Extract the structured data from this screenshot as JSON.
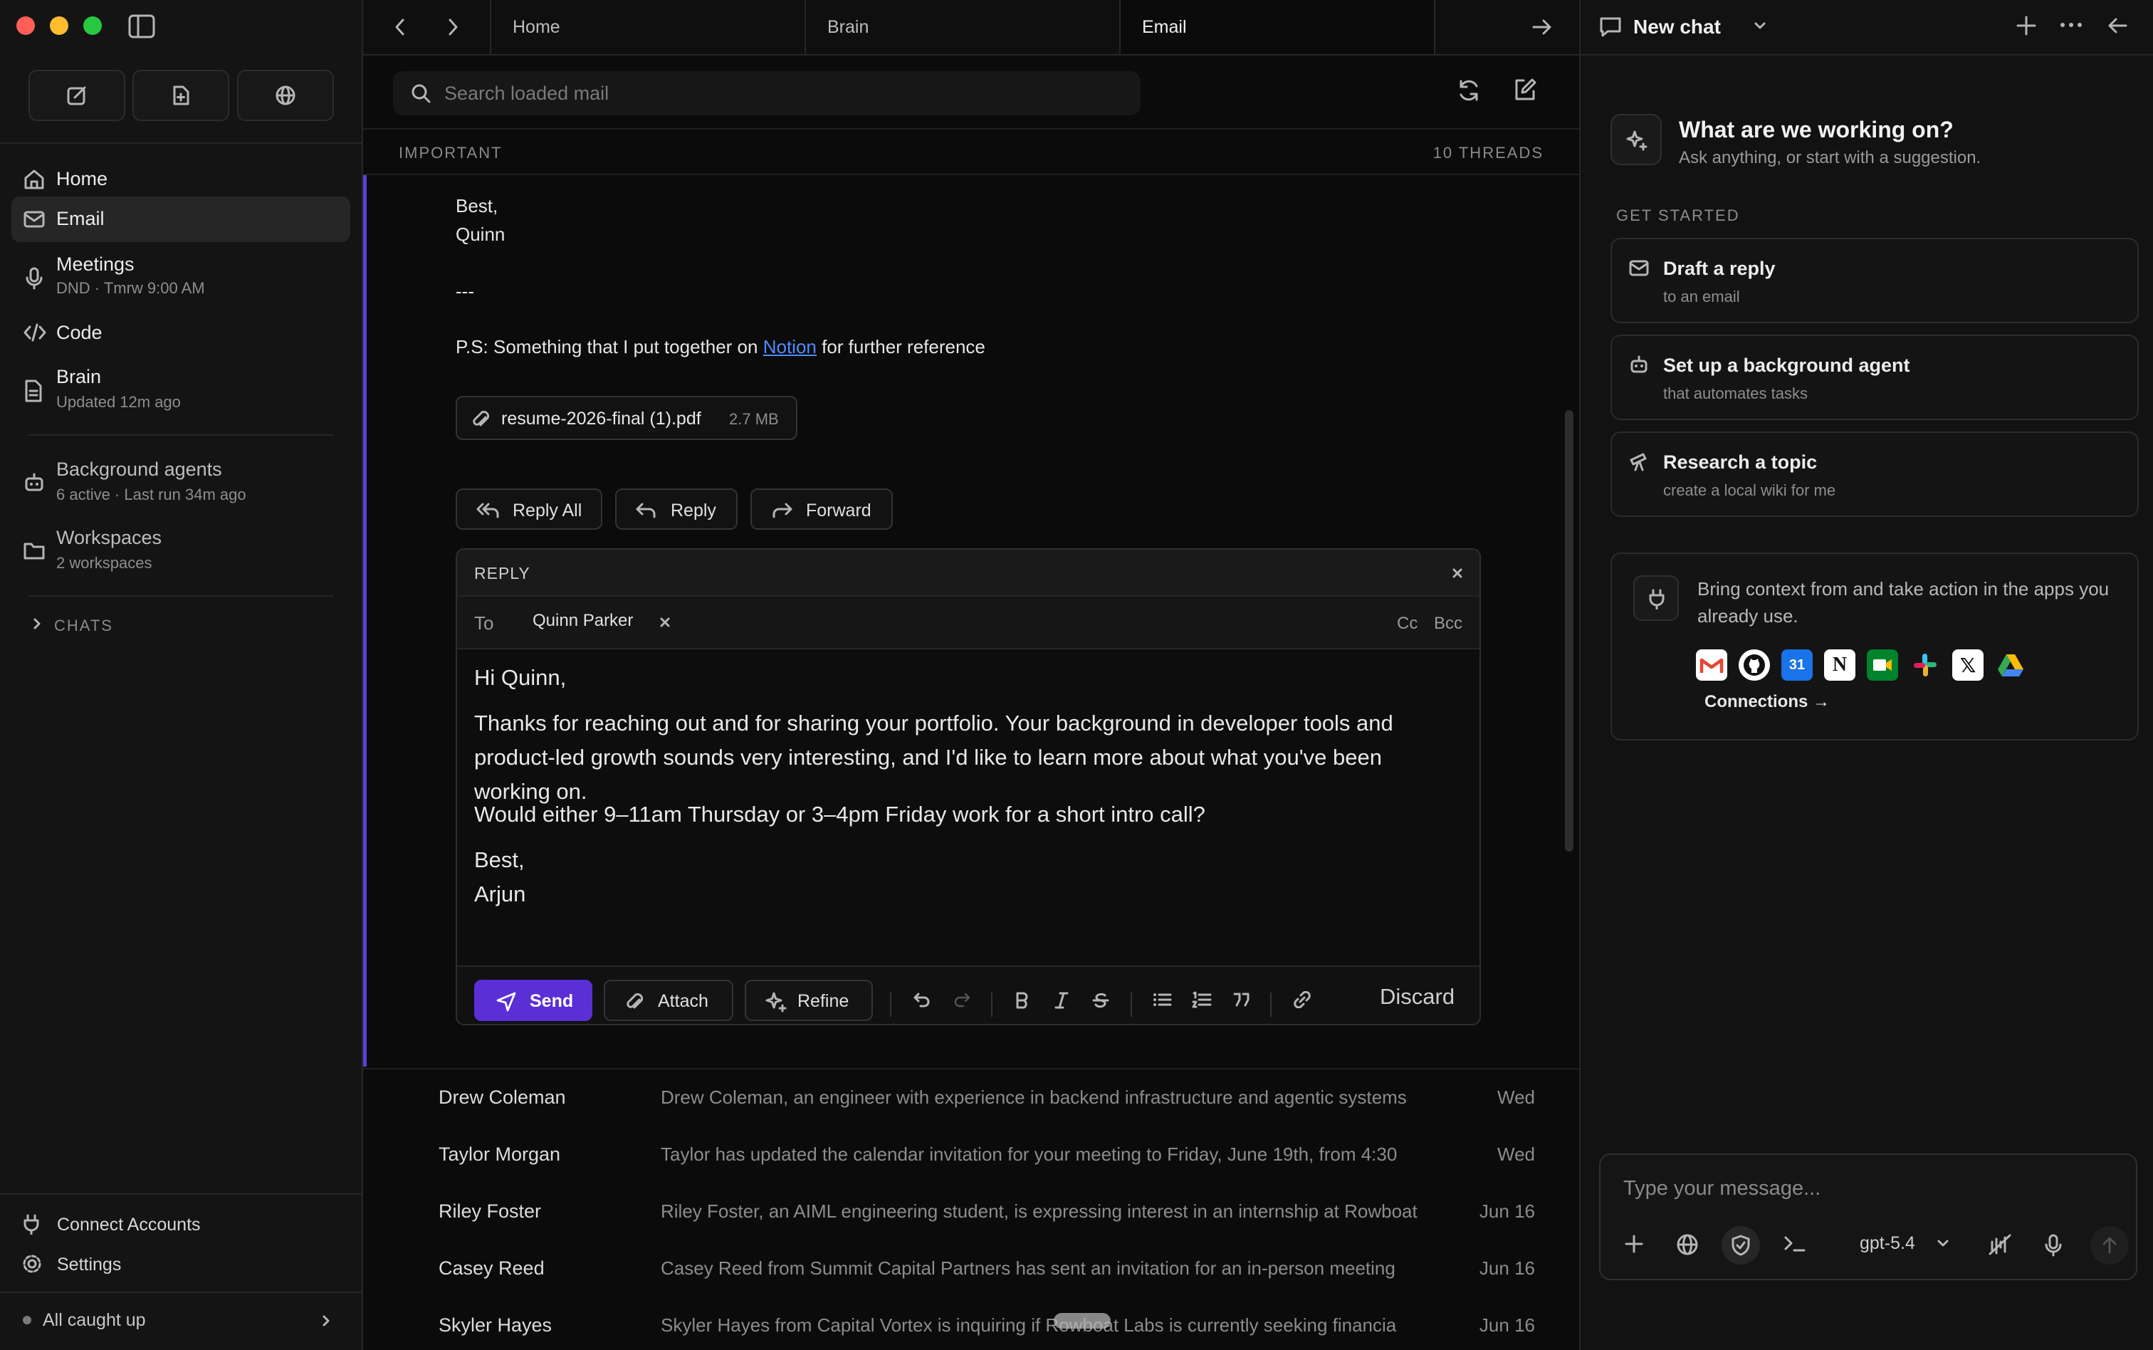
{
  "sidebar": {
    "nav": [
      {
        "label": "Home",
        "sub": ""
      },
      {
        "label": "Email",
        "sub": ""
      },
      {
        "label": "Meetings",
        "sub": "DND · Tmrw 9:00 AM"
      },
      {
        "label": "Code",
        "sub": ""
      },
      {
        "label": "Brain",
        "sub": "Updated 12m ago"
      },
      {
        "label": "Background agents",
        "sub": "6 active · Last run 34m ago"
      },
      {
        "label": "Workspaces",
        "sub": "2 workspaces"
      }
    ],
    "chats_label": "CHATS",
    "connect_accounts": "Connect Accounts",
    "settings": "Settings",
    "status": "All caught up"
  },
  "tabs": [
    "Home",
    "Brain",
    "Email"
  ],
  "mail": {
    "search_placeholder": "Search loaded mail",
    "section_label": "IMPORTANT",
    "thread_count": "10 THREADS",
    "body": {
      "signoff": "Best,",
      "signer": "Quinn",
      "separator": "---",
      "ps_before": "P.S: Something that I put together on ",
      "ps_link": "Notion",
      "ps_after": " for further reference"
    },
    "attachment": {
      "name": "resume-2026-final (1).pdf",
      "size": "2.7 MB"
    },
    "actions": {
      "reply_all": "Reply All",
      "reply": "Reply",
      "forward": "Forward"
    },
    "reply": {
      "title": "REPLY",
      "to_label": "To",
      "recipient": "Quinn Parker",
      "cc": "Cc",
      "bcc": "Bcc",
      "greeting": "Hi Quinn,",
      "para1": "Thanks for reaching out and for sharing your portfolio. Your background in developer tools and product-led growth sounds very interesting, and I'd like to learn more about what you've been working on.",
      "para2": "Would either 9–11am Thursday or 3–4pm Friday work for a short intro call?",
      "closing": "Best,",
      "name": "Arjun",
      "send": "Send",
      "attach": "Attach",
      "refine": "Refine",
      "discard": "Discard"
    },
    "threads": [
      {
        "sender": "Drew Coleman",
        "snippet": "Drew Coleman, an engineer with experience in backend infrastructure and agentic systems",
        "date": "Wed"
      },
      {
        "sender": "Taylor Morgan",
        "snippet": "Taylor has updated the calendar invitation for your meeting to Friday, June 19th, from 4:30",
        "date": "Wed"
      },
      {
        "sender": "Riley Foster",
        "snippet": "Riley Foster, an AIML engineering student, is expressing interest in an internship at Rowboat",
        "date": "Jun 16"
      },
      {
        "sender": "Casey Reed",
        "snippet": "Casey Reed from Summit Capital Partners has sent an invitation for an in-person meeting",
        "date": "Jun 16"
      },
      {
        "sender": "Skyler Hayes",
        "snippet": "Skyler Hayes from Capital Vortex is inquiring if Rowboat Labs is currently seeking financia",
        "date": "Jun 16"
      }
    ]
  },
  "chat": {
    "title": "New chat",
    "heading": "What are we working on?",
    "subheading": "Ask anything, or start with a suggestion.",
    "get_started": "GET STARTED",
    "suggestions": [
      {
        "title": "Draft a reply",
        "sub": "to an email",
        "icon": "mail-icon"
      },
      {
        "title": "Set up a background agent",
        "sub": "that automates tasks",
        "icon": "bot-icon"
      },
      {
        "title": "Research a topic",
        "sub": "create a local wiki for me",
        "icon": "telescope-icon"
      }
    ],
    "context_text": "Bring context from and take action in the apps you already use.",
    "connections": "Connections →",
    "apps": [
      "gmail",
      "github",
      "google-calendar",
      "notion",
      "google-meet",
      "slack",
      "x",
      "google-drive"
    ],
    "calendar_day": "31",
    "input_placeholder": "Type your message...",
    "model": "gpt-5.4"
  },
  "colors": {
    "accent": "#5b3fe0",
    "link": "#4d8dff",
    "send": "#5a2fd6"
  }
}
